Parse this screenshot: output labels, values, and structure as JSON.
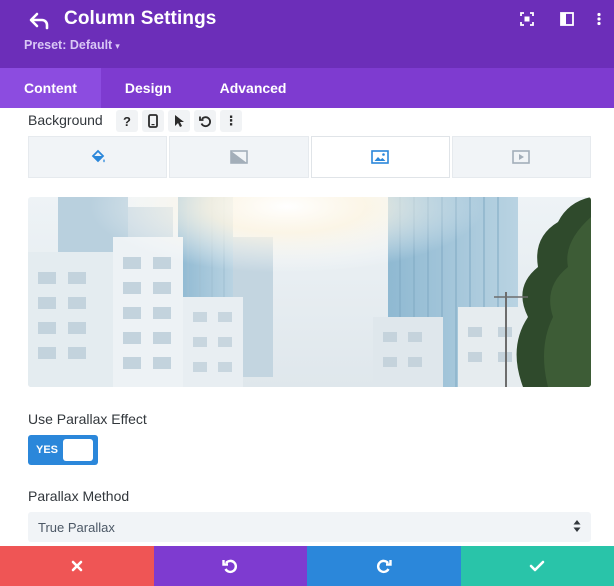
{
  "header": {
    "title": "Column Settings",
    "preset_label": "Preset: Default",
    "preset_caret": "▾",
    "icons": [
      "back-icon",
      "fullscreen-icon",
      "split-view-icon"
    ]
  },
  "tabs": [
    {
      "label": "Content",
      "active": true
    },
    {
      "label": "Design",
      "active": false
    },
    {
      "label": "Advanced",
      "active": false
    }
  ],
  "background": {
    "label": "Background",
    "tools": [
      {
        "name": "help-icon",
        "glyph": "?"
      },
      {
        "name": "mobile-icon",
        "glyph": ""
      },
      {
        "name": "hover-cursor-icon",
        "glyph": ""
      },
      {
        "name": "reset-icon",
        "glyph": ""
      },
      {
        "name": "more-options-icon",
        "glyph": "⋮"
      }
    ],
    "types": [
      {
        "name": "color-fill-icon",
        "active": false
      },
      {
        "name": "gradient-icon",
        "active": false
      },
      {
        "name": "image-icon",
        "active": true
      },
      {
        "name": "video-icon",
        "active": false
      }
    ]
  },
  "parallax": {
    "label": "Use Parallax Effect",
    "toggle_text": "YES",
    "enabled": true
  },
  "method": {
    "label": "Parallax Method",
    "value": "True Parallax"
  },
  "colors": {
    "header": "#6c2eb9",
    "tabs": "#7e3bd0",
    "tab_active": "#8c4ce0",
    "toggle": "#2b87da",
    "discard": "#ef5555",
    "undo": "#7e3bd0",
    "redo": "#2b87da",
    "save": "#29c4a9"
  },
  "footer": {
    "buttons": [
      "close-icon",
      "undo-icon",
      "redo-icon",
      "check-icon"
    ]
  }
}
